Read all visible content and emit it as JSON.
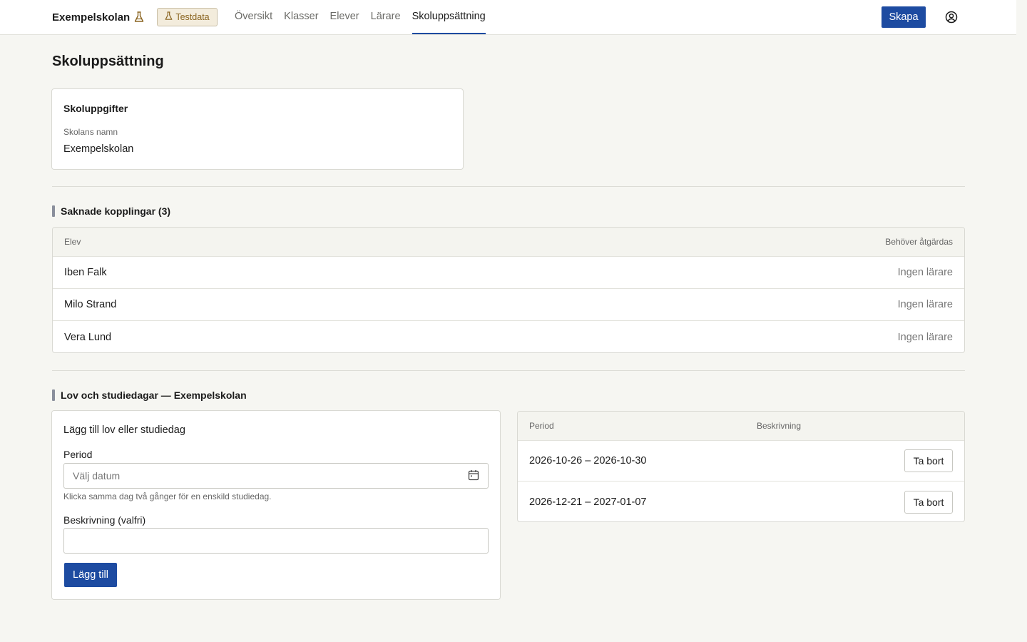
{
  "header": {
    "brand": "Exempelskolan",
    "badge": "Testdata",
    "nav": [
      "Översikt",
      "Klasser",
      "Elever",
      "Lärare",
      "Skoluppsättning"
    ],
    "active_nav": "Skoluppsättning",
    "create_label": "Skapa",
    "accent": "#1d4ba1"
  },
  "page": {
    "title": "Skoluppsättning"
  },
  "school_card": {
    "title": "Skoluppgifter",
    "field_label": "Skolans namn",
    "field_value": "Exempelskolan"
  },
  "missing": {
    "heading": "Saknade kopplingar (3)",
    "columns": [
      "Elev",
      "Behöver åtgärdas"
    ],
    "rows": [
      {
        "student": "Iben Falk",
        "issue": "Ingen lärare"
      },
      {
        "student": "Milo Strand",
        "issue": "Ingen lärare"
      },
      {
        "student": "Vera Lund",
        "issue": "Ingen lärare"
      }
    ]
  },
  "holidays": {
    "heading": "Lov och studiedagar — Exempelskolan",
    "form": {
      "title": "Lägg till lov eller studiedag",
      "period_label": "Period",
      "period_placeholder": "Välj datum",
      "hint": "Klicka samma dag två gånger för en enskild studiedag.",
      "description_label": "Beskrivning (valfri)",
      "description_value": "",
      "submit_label": "Lägg till"
    },
    "table": {
      "columns": [
        "Period",
        "Beskrivning"
      ],
      "rows": [
        {
          "period": "2026-10-26 – 2026-10-30",
          "description": "",
          "remove_label": "Ta bort"
        },
        {
          "period": "2026-12-21 – 2027-01-07",
          "description": "",
          "remove_label": "Ta bort"
        }
      ]
    }
  }
}
